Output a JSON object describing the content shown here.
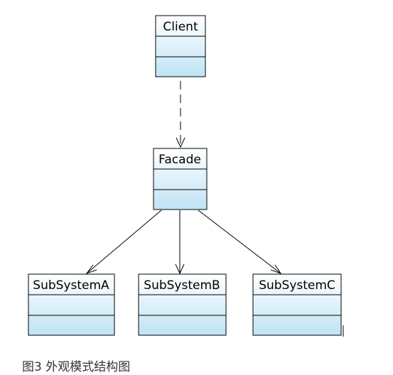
{
  "diagram": {
    "type": "UML class diagram",
    "classes": [
      {
        "id": "client",
        "name": "Client"
      },
      {
        "id": "facade",
        "name": "Facade"
      },
      {
        "id": "subsystem-a",
        "name": "SubSystemA"
      },
      {
        "id": "subsystem-b",
        "name": "SubSystemB"
      },
      {
        "id": "subsystem-c",
        "name": "SubSystemC"
      }
    ],
    "relations": [
      {
        "from": "client",
        "to": "facade",
        "kind": "dependency",
        "line": "dashed",
        "arrow": "open"
      },
      {
        "from": "facade",
        "to": "subsystem-a",
        "kind": "association",
        "line": "solid",
        "arrow": "open"
      },
      {
        "from": "facade",
        "to": "subsystem-b",
        "kind": "association",
        "line": "solid",
        "arrow": "open"
      },
      {
        "from": "facade",
        "to": "subsystem-c",
        "kind": "association",
        "line": "solid",
        "arrow": "open"
      }
    ]
  },
  "caption": "图3 外观模式结构图",
  "colors": {
    "box_gradient_top": "#ffffff",
    "box_gradient_bottom": "#bfe3f5",
    "box_border": "#000000",
    "line": "#000000",
    "caption_text": "#333333"
  }
}
